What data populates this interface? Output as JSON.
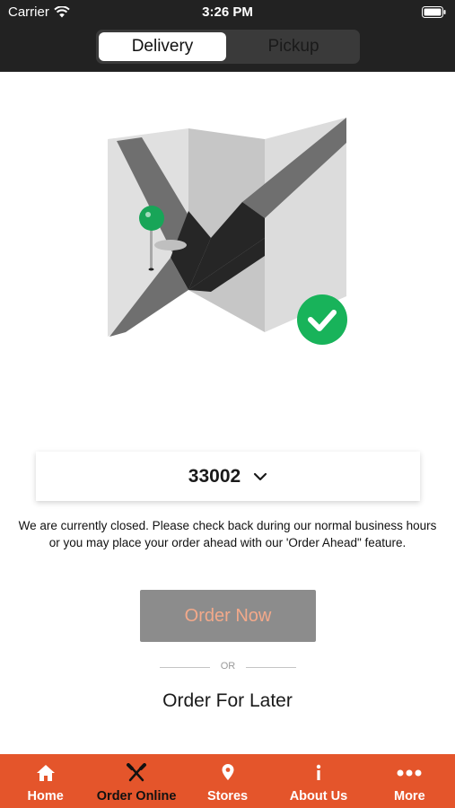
{
  "status_bar": {
    "carrier": "Carrier",
    "time": "3:26 PM"
  },
  "order_type": {
    "options": [
      "Delivery",
      "Pickup"
    ],
    "selected": "Delivery"
  },
  "location": {
    "zip": "33002"
  },
  "closed_message": "We are currently closed.  Please check back during our normal business hours or you may place your order ahead with our 'Order Ahead\" feature.",
  "actions": {
    "order_now": "Order Now",
    "or": "OR",
    "order_later": "Order For Later"
  },
  "tabs": [
    {
      "label": "Home",
      "icon": "home-icon"
    },
    {
      "label": "Order Online",
      "icon": "fork-knife-icon",
      "active": true
    },
    {
      "label": "Stores",
      "icon": "location-pin-icon"
    },
    {
      "label": "About Us",
      "icon": "info-icon"
    },
    {
      "label": "More",
      "icon": "more-dots-icon"
    }
  ],
  "colors": {
    "header": "#222222",
    "tab_bar": "#e4552b",
    "order_now_bg": "#8c8c8c",
    "order_now_text": "#f3a98a",
    "pin": "#18a558",
    "check_badge": "#18b35a"
  }
}
